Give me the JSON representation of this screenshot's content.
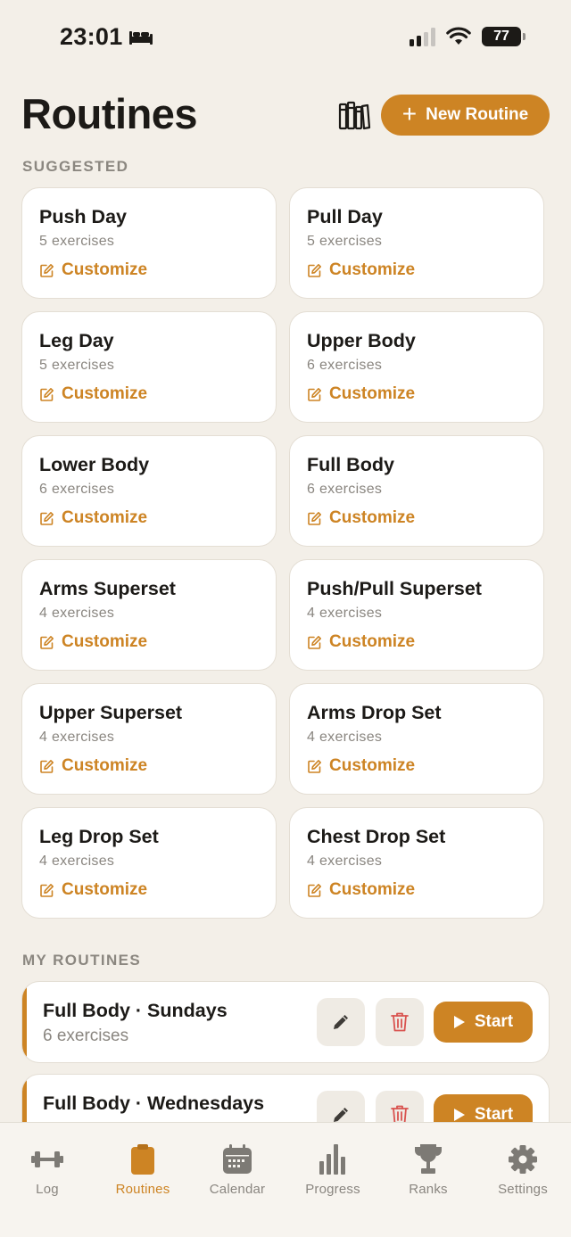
{
  "status_bar": {
    "time": "23:01",
    "battery": "77"
  },
  "header": {
    "title": "Routines",
    "new_routine_label": "New Routine"
  },
  "sections": {
    "suggested": "SUGGESTED",
    "my_routines": "MY ROUTINES"
  },
  "suggested": [
    {
      "title": "Push Day",
      "subtitle": "5 exercises",
      "action": "Customize"
    },
    {
      "title": "Pull Day",
      "subtitle": "5 exercises",
      "action": "Customize"
    },
    {
      "title": "Leg Day",
      "subtitle": "5 exercises",
      "action": "Customize"
    },
    {
      "title": "Upper Body",
      "subtitle": "6 exercises",
      "action": "Customize"
    },
    {
      "title": "Lower Body",
      "subtitle": "6 exercises",
      "action": "Customize"
    },
    {
      "title": "Full Body",
      "subtitle": "6 exercises",
      "action": "Customize"
    },
    {
      "title": "Arms Superset",
      "subtitle": "4 exercises",
      "action": "Customize"
    },
    {
      "title": "Push/Pull Superset",
      "subtitle": "4 exercises",
      "action": "Customize"
    },
    {
      "title": "Upper Superset",
      "subtitle": "4 exercises",
      "action": "Customize"
    },
    {
      "title": "Arms Drop Set",
      "subtitle": "4 exercises",
      "action": "Customize"
    },
    {
      "title": "Leg Drop Set",
      "subtitle": "4 exercises",
      "action": "Customize"
    },
    {
      "title": "Chest Drop Set",
      "subtitle": "4 exercises",
      "action": "Customize"
    }
  ],
  "my_routines": [
    {
      "title": "Full Body · Sundays",
      "subtitle": "6 exercises",
      "start_label": "Start"
    },
    {
      "title": "Full Body · Wednesdays",
      "subtitle": "",
      "start_label": "Start"
    }
  ],
  "tabs": [
    {
      "label": "Log",
      "icon": "dumbbell-icon"
    },
    {
      "label": "Routines",
      "icon": "clipboard-icon",
      "active": true
    },
    {
      "label": "Calendar",
      "icon": "calendar-icon"
    },
    {
      "label": "Progress",
      "icon": "bar-chart-icon"
    },
    {
      "label": "Ranks",
      "icon": "trophy-icon"
    },
    {
      "label": "Settings",
      "icon": "gear-icon"
    }
  ],
  "colors": {
    "accent": "#cd8424",
    "background": "#f3efe8",
    "card": "#ffffff",
    "muted": "#8a8680",
    "delete": "#d9534f"
  }
}
